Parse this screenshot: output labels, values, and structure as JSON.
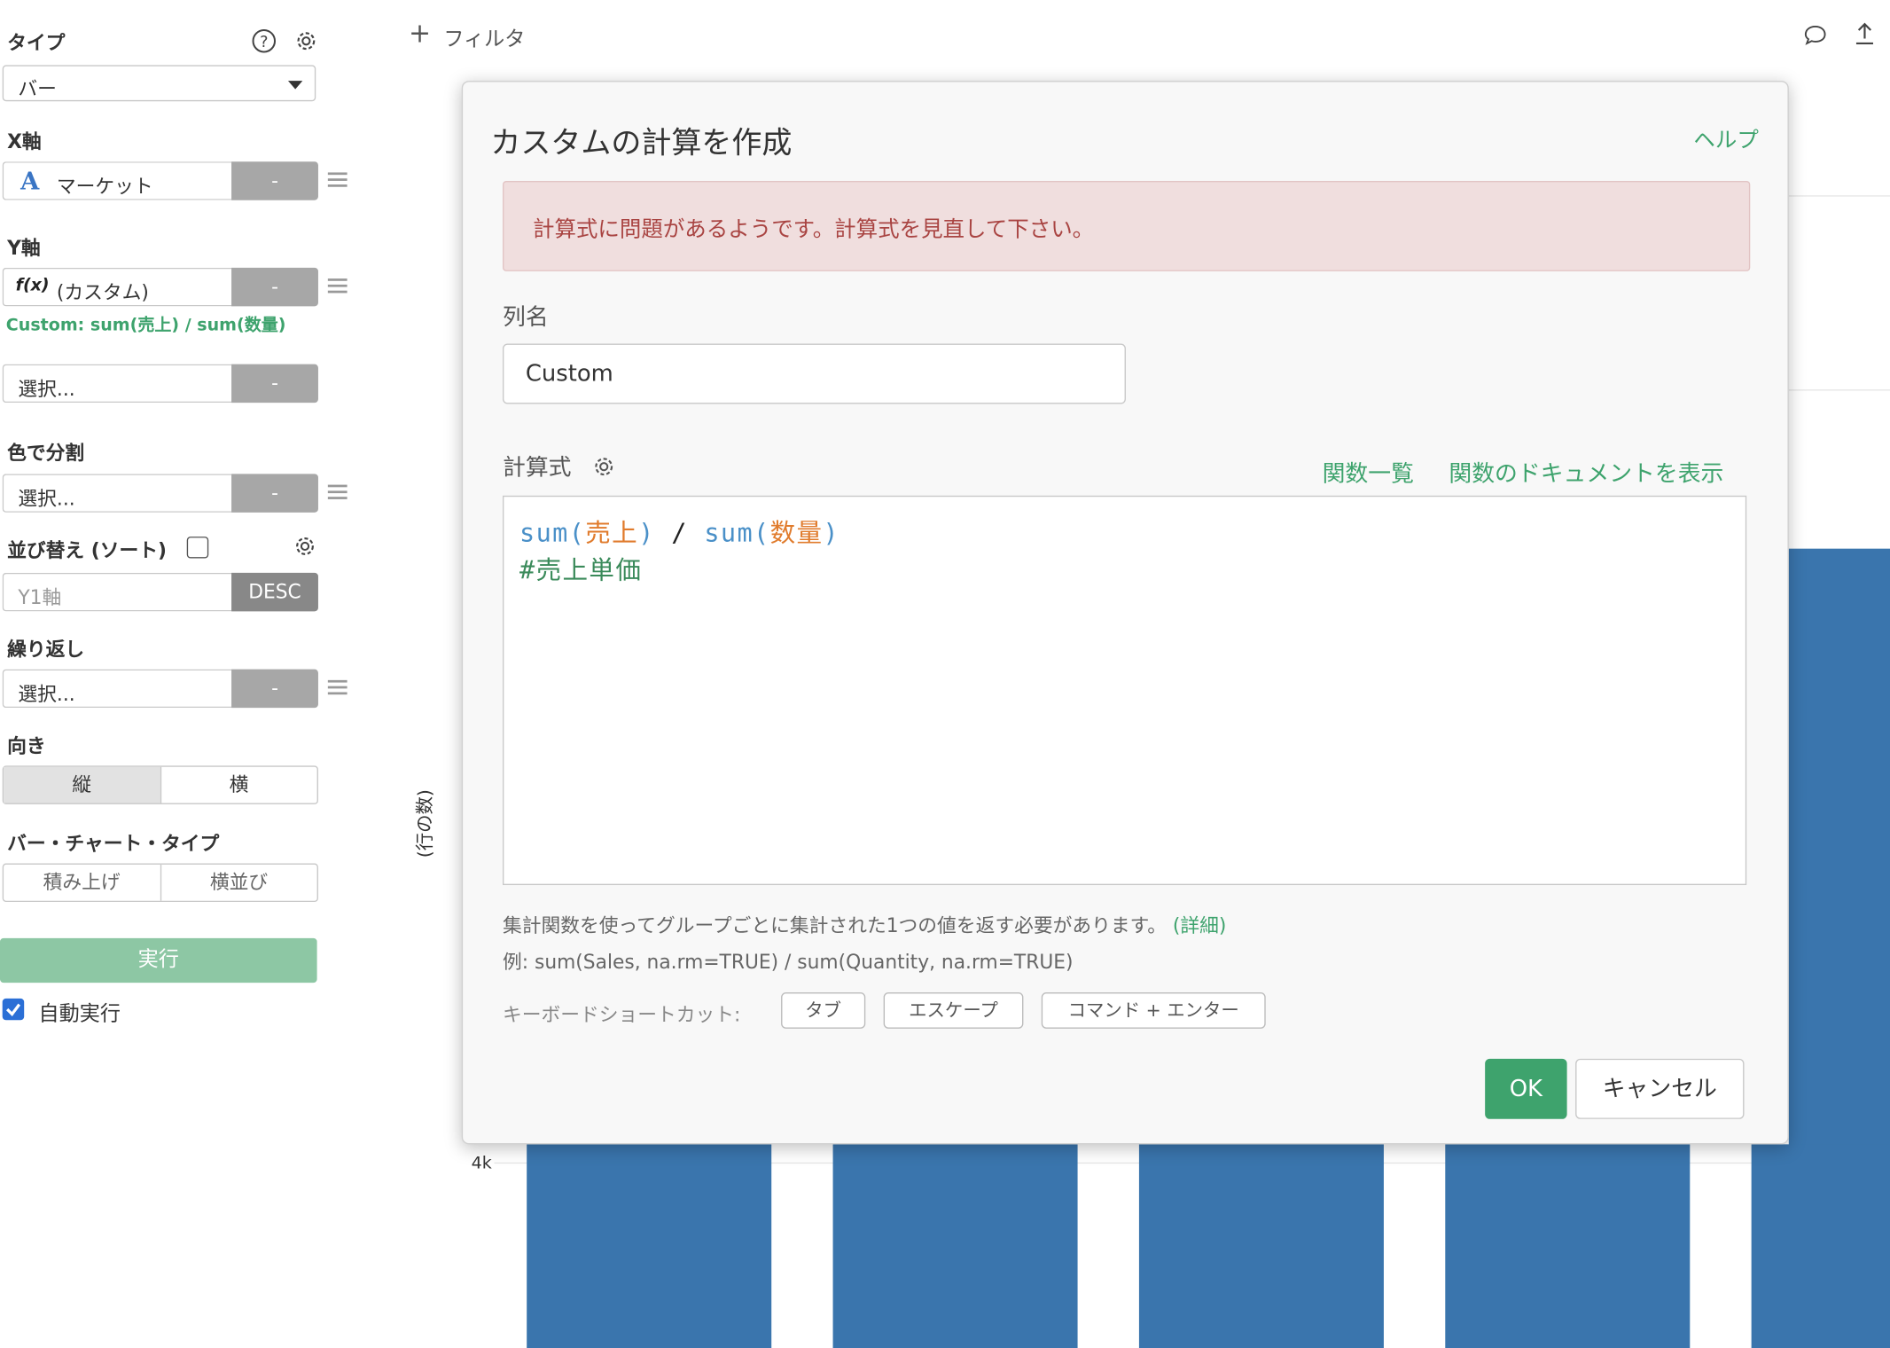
{
  "left_panel": {
    "type_label": "タイプ",
    "type_value": "バー",
    "xaxis_label": "X軸",
    "xaxis_value": "マーケット",
    "xaxis_type_glyph": "A",
    "xaxis_btn": "-",
    "yaxis_label": "Y軸",
    "yaxis_value": "(カスタム)",
    "yaxis_type_glyph": "f(x)",
    "yaxis_btn": "-",
    "custom_note": "Custom: sum(売上) / sum(数量)",
    "y2_placeholder": "選択...",
    "y2_btn": "-",
    "color_label": "色で分割",
    "color_placeholder": "選択...",
    "color_btn": "-",
    "sort_label": "並び替え (ソート)",
    "sort_placeholder": "Y1軸",
    "sort_btn": "DESC",
    "repeat_label": "繰り返し",
    "repeat_placeholder": "選択...",
    "repeat_btn": "-",
    "orientation_label": "向き",
    "orientation_options": [
      "縦",
      "横"
    ],
    "bartype_label": "バー・チャート・タイプ",
    "bartype_options": [
      "積み上げ",
      "横並び"
    ],
    "run_button": "実行",
    "auto_run_label": "自動実行"
  },
  "toolbar": {
    "filter_label": "フィルタ"
  },
  "chart": {
    "ylabel": "(行の数)",
    "tick_4k": "4k",
    "accent": "#3a75ad"
  },
  "modal": {
    "title": "カスタムの計算を作成",
    "help_link": "ヘルプ",
    "error_message": "計算式に問題があるようです。計算式を見直して下さい。",
    "column_name_label": "列名",
    "column_name_value": "Custom",
    "formula_label": "計算式",
    "functions_list_link": "関数一覧",
    "functions_doc_link": "関数のドキュメントを表示",
    "code": {
      "fn1": "sum",
      "arg1": "売上",
      "op": "/",
      "fn2": "sum",
      "arg2": "数量",
      "comment": "#売上単価"
    },
    "note_text": "集計関数を使ってグループごとに集計された1つの値を返す必要があります。",
    "note_link": "(詳細)",
    "example_text": "例: sum(Sales, na.rm=TRUE) / sum(Quantity, na.rm=TRUE)",
    "shortcut_label": "キーボードショートカット:",
    "shortcuts": [
      "タブ",
      "エスケープ",
      "コマンド + エンター"
    ],
    "ok_button": "OK",
    "cancel_button": "キャンセル",
    "colors": {
      "ok": "#3ea36d",
      "error_bg": "#f0dede",
      "error_text": "#a94442",
      "code_fn": "#4a90c8",
      "code_arg": "#e07b2c",
      "code_comment": "#3a8a5a"
    }
  }
}
